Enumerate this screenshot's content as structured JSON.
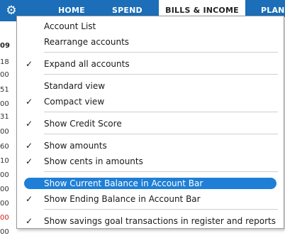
{
  "nav": {
    "tabs": [
      {
        "label": "HOME"
      },
      {
        "label": "SPEND"
      },
      {
        "label": "BILLS & INCOME"
      },
      {
        "label": "PLAN"
      }
    ]
  },
  "background_column": {
    "header": "09",
    "numbers": [
      "18",
      "00",
      "51",
      "00",
      "31",
      "00",
      "60",
      "10",
      "00",
      "00",
      "00",
      "00",
      "00",
      "00"
    ]
  },
  "menu": {
    "items": [
      {
        "label": "Account List",
        "checked": false
      },
      {
        "label": "Rearrange accounts",
        "checked": false
      },
      {
        "label": "Expand all accounts",
        "checked": true
      },
      {
        "label": "Standard view",
        "checked": false
      },
      {
        "label": "Compact view",
        "checked": true
      },
      {
        "label": "Show Credit Score",
        "checked": true
      },
      {
        "label": "Show amounts",
        "checked": true
      },
      {
        "label": "Show cents in amounts",
        "checked": true
      },
      {
        "label": "Show Current Balance in Account Bar",
        "checked": false,
        "highlighted": true
      },
      {
        "label": "Show Ending Balance in Account Bar",
        "checked": true
      },
      {
        "label": "Show savings goal transactions in register and reports",
        "checked": true
      }
    ],
    "check_glyph": "✓"
  },
  "colors": {
    "accent": "#1b6eb7",
    "highlight": "#1f7fd6",
    "negative": "#cc2222"
  },
  "icons": {
    "settings": "gear-icon",
    "check": "checkmark-icon"
  }
}
